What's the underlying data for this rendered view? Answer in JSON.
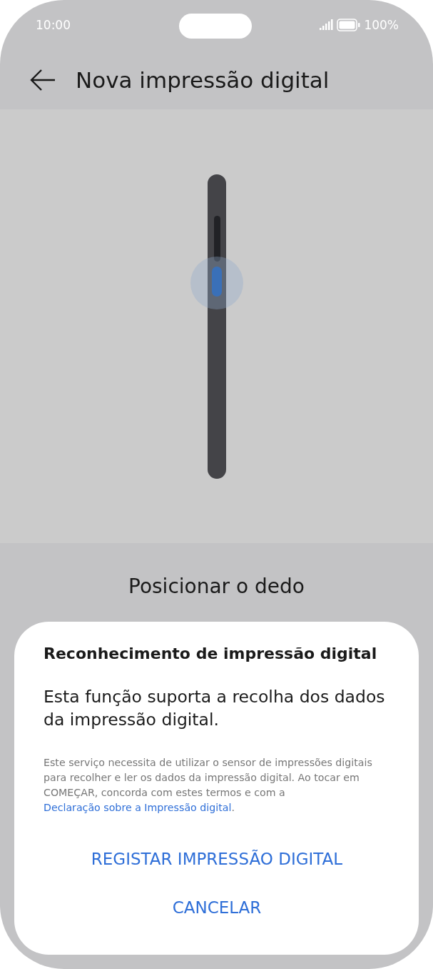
{
  "status_bar": {
    "time": "10:00",
    "battery": "100%"
  },
  "header": {
    "title": "Nova impressão digital"
  },
  "instruction": {
    "title": "Posicionar o dedo"
  },
  "dialog": {
    "title": "Reconhecimento de impressão digital",
    "message": "Esta função suporta a recolha dos dados da impressão digital.",
    "notice": "Este serviço necessita de utilizar o sensor de impressões digitais para recolher e ler os dados da impressão digital. Ao tocar em COMEÇAR, concorda com estes termos e com a",
    "link": "Declaração sobre a Impressão digital",
    "link_suffix": ".",
    "buttons": [
      "REGISTAR IMPRESSÃO DIGITAL",
      "CANCELAR"
    ]
  }
}
